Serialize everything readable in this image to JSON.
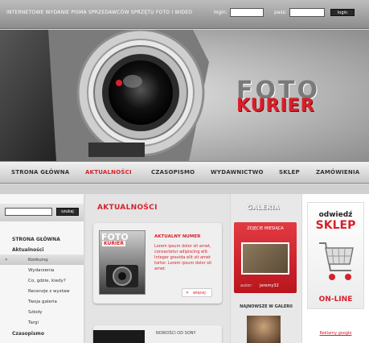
{
  "header": {
    "tagline": "INTERNETOWE WYDANIE PISMA SPRZEDAWCÓW SPRZĘTU FOTO I WIDEO",
    "login_label": "login:",
    "pass_label": "pass:",
    "login_button": "login"
  },
  "brand": {
    "foto": "FOTO",
    "kurier": "KURIER"
  },
  "nav": [
    {
      "label": "STRONA GŁÓWNA"
    },
    {
      "label": "AKTUALNOŚCI"
    },
    {
      "label": "CZASOPISMO"
    },
    {
      "label": "WYDAWNICTWO"
    },
    {
      "label": "SKLEP"
    },
    {
      "label": "ZAMÓWIENIA"
    }
  ],
  "sidebar": {
    "search_button": "szukaj",
    "items": [
      {
        "label": "STRONA GŁÓWNA"
      },
      {
        "label": "Aktualności"
      },
      {
        "label": "Konkursy"
      },
      {
        "label": "Wydarzenia"
      },
      {
        "label": "Co, gdzie, kiedy?"
      },
      {
        "label": "Recenzje z wystaw"
      },
      {
        "label": "Twoja galeria"
      },
      {
        "label": "Szkoły"
      },
      {
        "label": "Targi"
      },
      {
        "label": "Czasopismo"
      }
    ]
  },
  "main": {
    "section_title": "AKTUALNOŚCI",
    "cover": {
      "foto": "FOTO",
      "kurier": "KURIER"
    },
    "card1": {
      "title": "AKTUALNY NUMER",
      "text": "Lorem ipsum dolor sit amet, consectetur adipiscing elit. Integer gravida elit sit amet tortor. Lorem ipsum dolor sit amet.",
      "more": "więcej"
    },
    "card2": {
      "title": "NOWOŚCI OD SONY"
    }
  },
  "gallery": {
    "title": "GALERIA",
    "photo_of_month": "ZDJĘCIE MIESIĄCA",
    "author_label": "autor:",
    "author_name": "Jeremy32",
    "newest": "NAJNOWSZE W GALERII"
  },
  "ad": {
    "line1": "odwiedź",
    "line2": "SKLEP",
    "line3": "ON-LINE",
    "link": "Reklamy google"
  },
  "colors": {
    "accent": "#d8202a",
    "dark": "#2a2a2a"
  }
}
